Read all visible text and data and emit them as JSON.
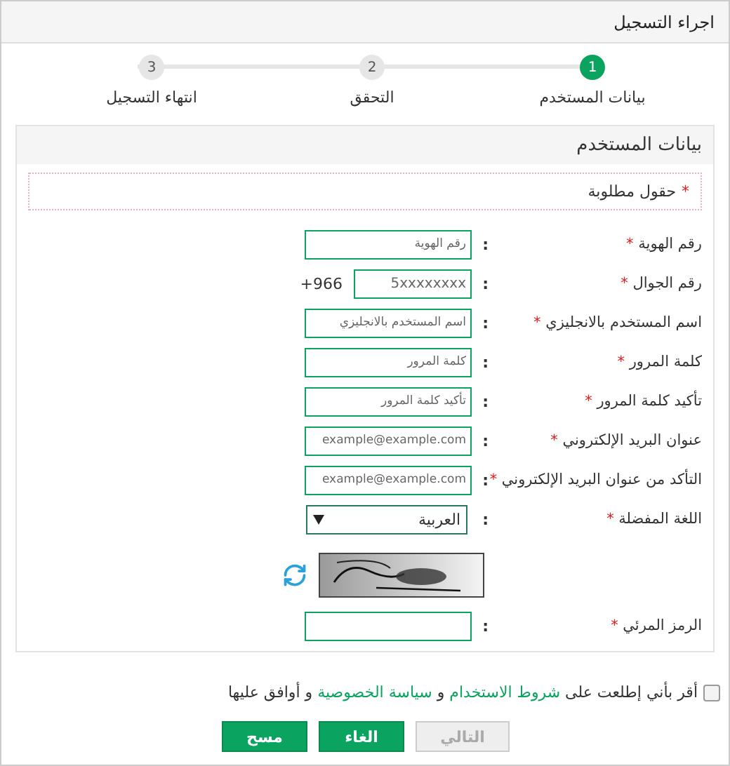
{
  "window": {
    "title": "اجراء التسجيل"
  },
  "steps": [
    {
      "number": "1",
      "label": "بيانات المستخدم",
      "selected": true
    },
    {
      "number": "2",
      "label": "التحقق",
      "selected": false
    },
    {
      "number": "3",
      "label": "انتهاء التسجيل",
      "selected": false
    }
  ],
  "panel": {
    "title": "بيانات المستخدم",
    "required_note": {
      "mark": "*",
      "text": "حقول مطلوبة"
    }
  },
  "fields": [
    {
      "kind": "text",
      "label": "رقم الهوية",
      "required": true,
      "placeholder": "رقم الهوية"
    },
    {
      "kind": "phone",
      "label": "رقم الجوال",
      "required": true,
      "placeholder": "5xxxxxxxx",
      "prefix": "+966"
    },
    {
      "kind": "text",
      "label": "اسم المستخدم بالانجليزي",
      "required": true,
      "placeholder": "اسم المستخدم بالانجليزي"
    },
    {
      "kind": "text",
      "label": "كلمة المرور",
      "required": true,
      "placeholder": "كلمة المرور"
    },
    {
      "kind": "text",
      "label": "تأكيد كلمة المرور",
      "required": true,
      "placeholder": "تأكيد كلمة المرور"
    },
    {
      "kind": "text",
      "label": "عنوان البريد الإلكتروني",
      "required": true,
      "placeholder": "example@example.com"
    },
    {
      "kind": "text",
      "label": "التأكد من عنوان البريد الإلكتروني",
      "required": true,
      "placeholder": "example@example.com"
    },
    {
      "kind": "select",
      "label": "اللغة المفضلة",
      "required": true,
      "value": "العربية"
    },
    {
      "kind": "captcha"
    },
    {
      "kind": "text",
      "label": "الرمز المرئي",
      "required": true
    }
  ],
  "colon": ":",
  "star": "*",
  "consent": {
    "checked": false,
    "parts": [
      {
        "kind": "text",
        "text": "أقر بأني إطلعت على "
      },
      {
        "kind": "link",
        "text": "شروط الاستخدام"
      },
      {
        "kind": "text",
        "text": " و "
      },
      {
        "kind": "link",
        "text": "سياسة الخصوصية"
      },
      {
        "kind": "text",
        "text": " و أوافق عليها"
      }
    ]
  },
  "buttons": [
    {
      "label": "التالي",
      "disabled": true
    },
    {
      "label": "الغاء",
      "disabled": false
    },
    {
      "label": "مسح",
      "disabled": false
    }
  ]
}
